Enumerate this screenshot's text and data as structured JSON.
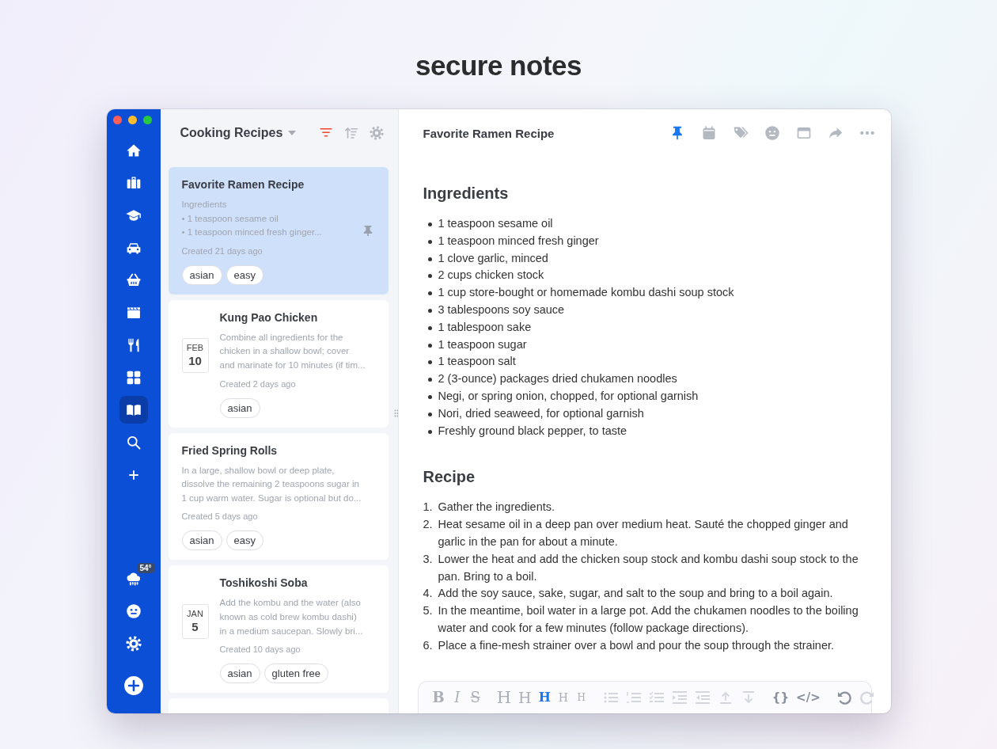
{
  "page_title": "secure notes",
  "nav": {
    "items": [
      {
        "selected": false
      },
      {
        "selected": false
      },
      {
        "selected": false
      },
      {
        "selected": false
      },
      {
        "selected": false
      },
      {
        "selected": false
      },
      {
        "selected": false
      },
      {
        "selected": false
      },
      {
        "selected": true
      },
      {
        "selected": false
      },
      {
        "selected": false
      }
    ],
    "weather": "54°"
  },
  "notes_list": {
    "title": "Cooking Recipes",
    "filter_active": true,
    "notes": [
      {
        "title": "Favorite Ramen Recipe",
        "preview": [
          "Ingredients",
          "• 1 teaspoon sesame oil",
          "• 1 teaspoon minced fresh ginger..."
        ],
        "created": "Created 21 days ago",
        "tags": [
          "asian",
          "easy"
        ],
        "selected": true,
        "pinned": true
      },
      {
        "title": "Kung Pao Chicken",
        "date": {
          "month": "FEB",
          "day": "10"
        },
        "preview": [
          "Combine all ingredients for the",
          "chicken in a shallow bowl; cover",
          "and marinate for 10 minutes (if tim..."
        ],
        "created": "Created 2 days ago",
        "tags": [
          "asian"
        ],
        "selected": false,
        "pinned": false
      },
      {
        "title": "Fried Spring Rolls",
        "preview": [
          "In a large, shallow bowl or deep plate,",
          "dissolve the remaining 2 teaspoons sugar in",
          "1 cup warm water. Sugar is optional but do..."
        ],
        "created": "Created 5 days ago",
        "tags": [
          "asian",
          "easy"
        ],
        "selected": false,
        "pinned": false
      },
      {
        "title": "Toshikoshi Soba",
        "date": {
          "month": "JAN",
          "day": "5"
        },
        "preview": [
          "Add the kombu and the water (also",
          "known as cold brew kombu dashi)",
          "in a medium saucepan. Slowly bri..."
        ],
        "created": "Created 10 days ago",
        "tags": [
          "asian",
          "gluten free"
        ],
        "selected": false,
        "pinned": false
      }
    ]
  },
  "editor": {
    "title": "Favorite Ramen Recipe",
    "pinned": true,
    "sections": [
      {
        "heading": "Ingredients",
        "kind": "bullets",
        "items": [
          {
            "text": "1 teaspoon sesame oil"
          },
          {
            "text": "1 teaspoon minced fresh ginger"
          },
          {
            "text": "1 clove garlic, minced"
          },
          {
            "text": "2 cups chicken stock"
          },
          {
            "text": "1 cup store-bought or homemade kombu dashi soup stock"
          },
          {
            "text": "3 tablespoons soy sauce"
          },
          {
            "text": "1 tablespoon sake"
          },
          {
            "text": "1 teaspoon sugar"
          },
          {
            "text": "1 teaspoon salt"
          },
          {
            "text": "2 (3-ounce) packages dried chukamen noodles"
          },
          {
            "text": "Negi, or spring onion, chopped, for optional garnish"
          },
          {
            "text": "Nori, dried seaweed, for optional garnish"
          },
          {
            "text": "Freshly ground black pepper, to taste"
          }
        ]
      },
      {
        "heading": "Recipe",
        "kind": "numbered",
        "items": [
          {
            "number": "1.",
            "text": "Gather the ingredients."
          },
          {
            "number": "2.",
            "text": "Heat sesame oil in a deep pan over medium heat. Sauté the chopped ginger and garlic in the pan for about a minute."
          },
          {
            "number": "3.",
            "text": "Lower the heat and add the chicken soup stock and kombu dashi soup stock to the pan. Bring to a boil."
          },
          {
            "number": "4.",
            "text": "Add the soy sauce, sake, sugar, and salt to the soup and bring to a boil again."
          },
          {
            "number": "5.",
            "text": "In the meantime, boil water in a large pot. Add the chukamen noodles to the boiling water and cook for a few minutes (follow package directions)."
          },
          {
            "number": "6.",
            "text": "Place a fine-mesh strainer over a bowl and pour the soup through the strainer."
          }
        ]
      }
    ],
    "format_toolbar": [
      [
        {
          "kind": "bold",
          "label": "B",
          "disabled": false
        },
        {
          "kind": "italic",
          "label": "I",
          "disabled": false
        },
        {
          "kind": "strike",
          "label": "S",
          "disabled": false
        }
      ],
      [
        {
          "kind": "heading",
          "label": "H",
          "selected": false
        },
        {
          "kind": "heading",
          "label": "H",
          "selected": false
        },
        {
          "kind": "heading",
          "label": "H",
          "selected": true
        },
        {
          "kind": "heading",
          "label": "H",
          "selected": false
        },
        {
          "kind": "heading",
          "label": "H",
          "selected": false
        }
      ],
      [
        {
          "kind": "bullets",
          "disabled": true
        },
        {
          "kind": "numbers",
          "disabled": true
        },
        {
          "kind": "checklist",
          "disabled": true
        },
        {
          "kind": "indent",
          "disabled": true
        },
        {
          "kind": "outdent",
          "disabled": true
        },
        {
          "kind": "up",
          "disabled": true
        },
        {
          "kind": "down",
          "disabled": true
        }
      ],
      [
        {
          "kind": "code",
          "label": "{}",
          "disabled": false
        },
        {
          "kind": "code",
          "label": "</>",
          "disabled": false
        }
      ],
      [
        {
          "kind": "undo",
          "disabled": false
        },
        {
          "kind": "redo",
          "disabled": true
        }
      ]
    ]
  }
}
